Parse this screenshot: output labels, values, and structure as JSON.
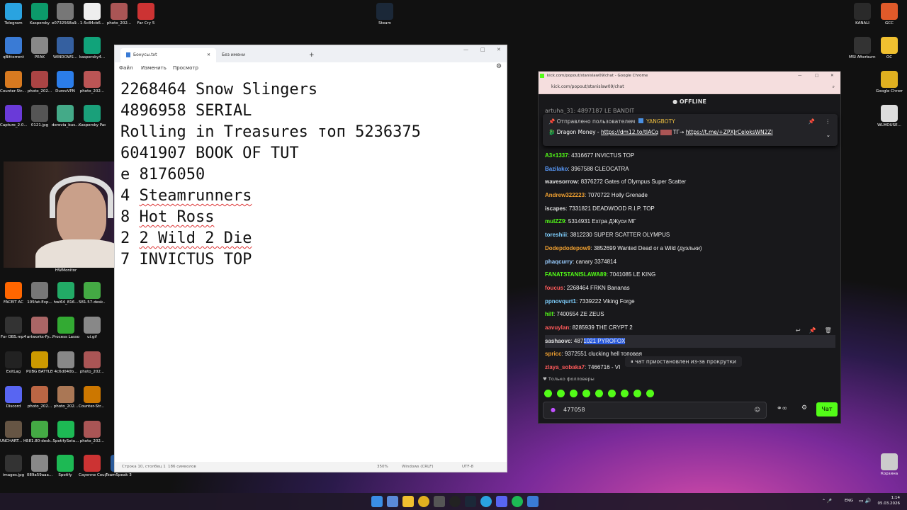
{
  "desktop": {
    "left_icons": [
      {
        "label": "Telegram",
        "color": "#2aa3e0"
      },
      {
        "label": "Kaspersky",
        "color": "#0c9a6a"
      },
      {
        "label": "e0732568a9...",
        "color": "#777"
      },
      {
        "label": "1-5c84cb6...",
        "color": "#eee"
      },
      {
        "label": "photo_202...",
        "color": "#a55"
      },
      {
        "label": "Far Cry 5",
        "color": "#c33"
      },
      {
        "label": "qBittorrent",
        "color": "#3a7bd5"
      },
      {
        "label": "PEAK",
        "color": "#888"
      },
      {
        "label": "WINDOWS...",
        "color": "#3560a0"
      },
      {
        "label": "kaspersky4...",
        "color": "#11a37a"
      },
      {
        "label": "Counter-Str... 2",
        "color": "#d87a20"
      },
      {
        "label": "photo_202...",
        "color": "#a44"
      },
      {
        "label": "DurevVPN",
        "color": "#2b7de9"
      },
      {
        "label": "photo_202...",
        "color": "#b55"
      },
      {
        "label": "Capture_2.0...",
        "color": "#6a3ad8"
      },
      {
        "label": "0121.jpg",
        "color": "#555"
      },
      {
        "label": "derevia_bus...",
        "color": "#4a8"
      },
      {
        "label": "Kaspersky Passwor...",
        "color": "#1aa07a"
      }
    ],
    "right_icons": [
      {
        "label": "Steam",
        "color": "#1b2838"
      },
      {
        "label": "KANALI",
        "color": "#2a2a2a"
      },
      {
        "label": "GCC",
        "color": "#e05a2a"
      },
      {
        "label": "MSI Afterburner",
        "color": "#333"
      },
      {
        "label": "OC",
        "color": "#f0c030"
      },
      {
        "label": "Google Chrome",
        "color": "#e0b020"
      },
      {
        "label": "WLMOUSE...",
        "color": "#ddd"
      },
      {
        "label": "Корзина",
        "color": "#ccc"
      }
    ],
    "bottom_icons": [
      {
        "label": "FACEIT AC",
        "color": "#f60"
      },
      {
        "label": "105fat-Exp...",
        "color": "#777"
      },
      {
        "label": "hwi64_816...",
        "color": "#2a6"
      },
      {
        "label": "581.57-desk...",
        "color": "#4a4"
      },
      {
        "label": "For OBS.mp4",
        "color": "#333"
      },
      {
        "label": "artworks-Fy...",
        "color": "#a66"
      },
      {
        "label": "Process Lasso",
        "color": "#3a3"
      },
      {
        "label": "ui.gif",
        "color": "#888"
      },
      {
        "label": "ExitLag",
        "color": "#222"
      },
      {
        "label": "PUBG BATTLEGR...",
        "color": "#c90"
      },
      {
        "label": "4c6d040b...",
        "color": "#888"
      },
      {
        "label": "photo_202...",
        "color": "#a55"
      },
      {
        "label": "Discord",
        "color": "#5865f2"
      },
      {
        "label": "photo_202...",
        "color": "#b64"
      },
      {
        "label": "photo_202...",
        "color": "#a75"
      },
      {
        "label": "Counter-Str... Global Offe...",
        "color": "#c70"
      },
      {
        "label": "UNCHART... Наследие...",
        "color": "#654"
      },
      {
        "label": "581.80-desk...",
        "color": "#4a4"
      },
      {
        "label": "SpotifySetu...",
        "color": "#1db954"
      },
      {
        "label": "photo_202...",
        "color": "#a55"
      },
      {
        "label": "images.jpg",
        "color": "#333"
      },
      {
        "label": "089a59aaa...",
        "color": "#888"
      },
      {
        "label": "Spotify",
        "color": "#1db954"
      },
      {
        "label": "Cayenne Coupé.pdf",
        "color": "#c33"
      },
      {
        "label": "TeamSpeak 3 Client",
        "color": "#2a5a9a"
      }
    ],
    "hwmonitor_label": "HWMonitor"
  },
  "notepad": {
    "tabs": [
      "Бонусы.txt",
      "Без имени"
    ],
    "tab_new": "+",
    "window_controls": [
      "—",
      "□",
      "✕"
    ],
    "menu": [
      "Файл",
      "Изменить",
      "Просмотр"
    ],
    "lines": [
      {
        "text": "2268464 Snow Slingers",
        "squiggle": ""
      },
      {
        "text": "4896958 SERIAL",
        "squiggle": ""
      },
      {
        "text": "Rolling in Treasures топ 5236375",
        "squiggle": ""
      },
      {
        "text": "6041907 BOOK OF TUT",
        "squiggle": ""
      },
      {
        "text": "e 8176050",
        "squiggle": ""
      },
      {
        "text": "4 Steamrunners",
        "squiggle": "Steamrunners"
      },
      {
        "text": "8 Hot Ross",
        "squiggle": "Hot Ross"
      },
      {
        "text": "2 2 Wild 2 Die",
        "squiggle": "2 Wild 2 Die"
      },
      {
        "text": "7 INVICTUS TOP",
        "squiggle": ""
      }
    ],
    "status": {
      "position": "Строка 10, столбец 1",
      "chars": "186 символов",
      "zoom": "350%",
      "eol": "Windows (CRLF)",
      "enc": "UTF-8"
    }
  },
  "chrome": {
    "title": "kick.com/popout/stanislaw09/chat - Google Chrome",
    "address": "kick.com/popout/stanislaw09/chat",
    "window_controls": [
      "—",
      "□",
      "✕"
    ],
    "offline": "OFFLINE",
    "top_partial": "artuha_31: 4897187 LE BANDIT",
    "pinned": {
      "sent_by": "Отправлено пользователем",
      "bot": "YANGBOTY",
      "text_prefix": "Dragon Money - ",
      "link1": "https://dm12.to/tIACq",
      "tg_label": "ТГ→",
      "link2": "https://t.me/+ZPXJrCeloksWN2Zl"
    },
    "messages": [
      {
        "user": "A3×1337",
        "color": "#53fc18",
        "text": "4316677 INVICTUS TOP"
      },
      {
        "user": "Bazilako",
        "color": "#5a9cff",
        "text": "3967588 CLEOCATRA"
      },
      {
        "user": "wavesorrow",
        "color": "#e0e0e0",
        "text": "8376272 Gates of Olympus Super Scatter"
      },
      {
        "user": "Andrew322223",
        "color": "#f0a030",
        "text": "7070722 Holly Grenade"
      },
      {
        "user": "iscapes",
        "color": "#e0e0e0",
        "text": "7331821 DEADWOOD R.I.P. TOP"
      },
      {
        "user": "mulZZ9",
        "color": "#53fc18",
        "text": "5314931 Ехтра ДЖуси МГ"
      },
      {
        "user": "toreshiii",
        "color": "#7fd0ff",
        "text": "3812230 SUPER SCATTER OLYMPUS"
      },
      {
        "user": "Dodepdodepow9",
        "color": "#f0a030",
        "text": "3852699 Wanted Dead or a Wild (дуэльки)"
      },
      {
        "user": "phaqcurry",
        "color": "#9cf",
        "text": "canary 3374814"
      },
      {
        "user": "FANATSTANISLAWA89",
        "color": "#53fc18",
        "text": "7041085 LE KING"
      },
      {
        "user": "foucus",
        "color": "#ff5a5a",
        "text": "2268464 FRKN Bananas"
      },
      {
        "user": "ppnovqurt1",
        "color": "#7fd0ff",
        "text": "7339222 Viking Forge"
      },
      {
        "user": "hilf",
        "color": "#53fc18",
        "text": "7400554 ZE ZEUS"
      },
      {
        "user": "aavuylan",
        "color": "#ff5a5a",
        "text": "8285939 THE CRYPT 2"
      },
      {
        "user": "sashaovc",
        "color": "#e0e0e0",
        "text": "4871021 PYROFOX"
      },
      {
        "user": "spricc",
        "color": "#f0a030",
        "text": "9372551 clucking hell топовая"
      },
      {
        "user": "zlaya_sobaka7",
        "color": "#ff5a5a",
        "text": "7466716 - VI"
      }
    ],
    "paused": "чат приостановлен из-за прокрутки",
    "followers_only": "Только фолловеры",
    "input_value": "477058",
    "send_label": "Чат"
  },
  "taskbar": {
    "lang": "ENG",
    "time": "1:14",
    "date": "05.03.2026"
  }
}
